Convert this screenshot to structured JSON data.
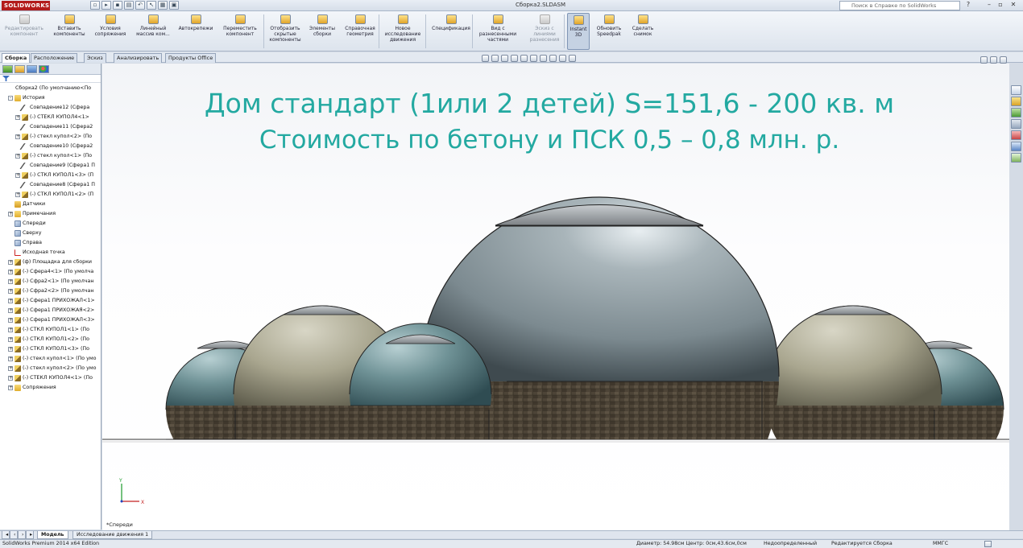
{
  "app": {
    "logo_text": "SOLIDWORKS",
    "document_title": "Сборка2.SLDASM",
    "help_search_placeholder": "Поиск в Справке по SolidWorks"
  },
  "commands": [
    {
      "label": "Редактировать компонент",
      "icon": "edit-component-icon",
      "enabled": false
    },
    {
      "label": "Вставить компоненты",
      "icon": "insert-components-icon",
      "enabled": true
    },
    {
      "label": "Условия сопряжения",
      "icon": "mate-icon",
      "enabled": true
    },
    {
      "label": "Линейный массив ком...",
      "icon": "linear-pattern-icon",
      "enabled": true
    },
    {
      "label": "Автокрепежи",
      "icon": "smart-fasteners-icon",
      "enabled": true
    },
    {
      "label": "Переместить компонент",
      "icon": "move-component-icon",
      "enabled": true
    },
    {
      "label": "Отобразить скрытые компоненты",
      "icon": "show-hidden-icon",
      "enabled": true
    },
    {
      "label": "Элементы сборки",
      "icon": "assembly-features-icon",
      "enabled": true
    },
    {
      "label": "Справочная геометрия",
      "icon": "reference-geometry-icon",
      "enabled": true
    },
    {
      "label": "Новое исследование движения",
      "icon": "motion-study-icon",
      "enabled": true
    },
    {
      "label": "Спецификация",
      "icon": "bom-icon",
      "enabled": true
    },
    {
      "label": "Вид с разнесенными частями",
      "icon": "exploded-view-icon",
      "enabled": true
    },
    {
      "label": "Эскиз с линиями разнесения",
      "icon": "explode-line-sketch-icon",
      "enabled": false
    },
    {
      "label": "Instant 3D",
      "icon": "instant3d-icon",
      "enabled": true,
      "pressed": true
    },
    {
      "label": "Обновить Speedpak",
      "icon": "speedpak-icon",
      "enabled": true
    },
    {
      "label": "Сделать снимок",
      "icon": "snapshot-icon",
      "enabled": true
    }
  ],
  "manager_tabs": [
    "Сборка",
    "Расположение",
    "Эскиз",
    "Анализировать",
    "Продукты Office"
  ],
  "tree": [
    {
      "label": "Сборка2 (По умолчанию<По",
      "icon": "assembly",
      "level": 0,
      "exp": ""
    },
    {
      "label": "История",
      "icon": "folder",
      "level": 1,
      "exp": "-"
    },
    {
      "label": "Совпадение12 (Сфера",
      "icon": "mate",
      "level": 2,
      "exp": ""
    },
    {
      "label": "(-) СТЕКЛ КУПОЛ4<1>",
      "icon": "part",
      "level": 2,
      "exp": "+"
    },
    {
      "label": "Совпадение11 (Сфера2",
      "icon": "mate",
      "level": 2,
      "exp": ""
    },
    {
      "label": "(-) стекл купол<2> (По",
      "icon": "part",
      "level": 2,
      "exp": "+"
    },
    {
      "label": "Совпадение10 (Сфера2",
      "icon": "mate",
      "level": 2,
      "exp": ""
    },
    {
      "label": "(-) стекл купол<1> (По",
      "icon": "part",
      "level": 2,
      "exp": "+"
    },
    {
      "label": "Совпадение9 (Сфера1 П",
      "icon": "mate",
      "level": 2,
      "exp": ""
    },
    {
      "label": "(-) СТКЛ КУПОЛ1<3> (П",
      "icon": "part",
      "level": 2,
      "exp": "+"
    },
    {
      "label": "Совпадение8 (Сфера1 П",
      "icon": "mate",
      "level": 2,
      "exp": ""
    },
    {
      "label": "(-) СТКЛ КУПОЛ1<2> (П",
      "icon": "part",
      "level": 2,
      "exp": "+"
    },
    {
      "label": "Датчики",
      "icon": "sensor",
      "level": 1,
      "exp": ""
    },
    {
      "label": "Примечания",
      "icon": "folder",
      "level": 1,
      "exp": "+"
    },
    {
      "label": "Спереди",
      "icon": "plane",
      "level": 1,
      "exp": ""
    },
    {
      "label": "Сверху",
      "icon": "plane",
      "level": 1,
      "exp": ""
    },
    {
      "label": "Справа",
      "icon": "plane",
      "level": 1,
      "exp": ""
    },
    {
      "label": "Исходная точка",
      "icon": "origin",
      "level": 1,
      "exp": ""
    },
    {
      "label": "(ф) Площадка для сборки",
      "icon": "part",
      "level": 1,
      "exp": "+"
    },
    {
      "label": "(-) Сфера4<1> (По умолча",
      "icon": "part",
      "level": 1,
      "exp": "+"
    },
    {
      "label": "(-) Сфра2<1> (По умолчан",
      "icon": "part",
      "level": 1,
      "exp": "+"
    },
    {
      "label": "(-) Сфра2<2> (По умолчан",
      "icon": "part",
      "level": 1,
      "exp": "+"
    },
    {
      "label": "(-) Сфера1 ПРИХОЖАЛ<1>",
      "icon": "part",
      "level": 1,
      "exp": "+"
    },
    {
      "label": "(-) Сфера1 ПРИХОЖАЯ<2>",
      "icon": "part",
      "level": 1,
      "exp": "+"
    },
    {
      "label": "(-) Сфера1 ПРИХОЖАЛ<3>",
      "icon": "part",
      "level": 1,
      "exp": "+"
    },
    {
      "label": "(-) СТКЛ КУПОЛ1<1> (По",
      "icon": "part",
      "level": 1,
      "exp": "+"
    },
    {
      "label": "(-) СТКЛ КУПОЛ1<2> (По",
      "icon": "part",
      "level": 1,
      "exp": "+"
    },
    {
      "label": "(-) СТКЛ КУПОЛ1<3> (По",
      "icon": "part",
      "level": 1,
      "exp": "+"
    },
    {
      "label": "(-) стекл купол<1> (По умо",
      "icon": "part",
      "level": 1,
      "exp": "+"
    },
    {
      "label": "(-) стекл купол<2> (По умо",
      "icon": "part",
      "level": 1,
      "exp": "+"
    },
    {
      "label": "(-) СТЕКЛ КУПОЛ4<1> (По",
      "icon": "part",
      "level": 1,
      "exp": "+"
    },
    {
      "label": "Сопряжения",
      "icon": "folder",
      "level": 1,
      "exp": "+"
    }
  ],
  "viewport": {
    "heading_line1": "Дом стандарт (1или 2 детей) S=151,6 - 200 кв. м",
    "heading_line2": "Стоимость по бетону и ПСК 0,5 – 0,8 млн. р.",
    "view_label": "*Спереди",
    "heading_color": "#23a9a1"
  },
  "bottom_tabs": [
    "Модель",
    "Исследование движения 1"
  ],
  "status": {
    "edition": "SolidWorks Premium 2014 x64 Edition",
    "measure": "Диаметр: 54.98см Центр: 0см,43.6см,0см",
    "state": "Недоопределенный",
    "mode": "Редактируется Сборка",
    "units": "ММГС"
  }
}
